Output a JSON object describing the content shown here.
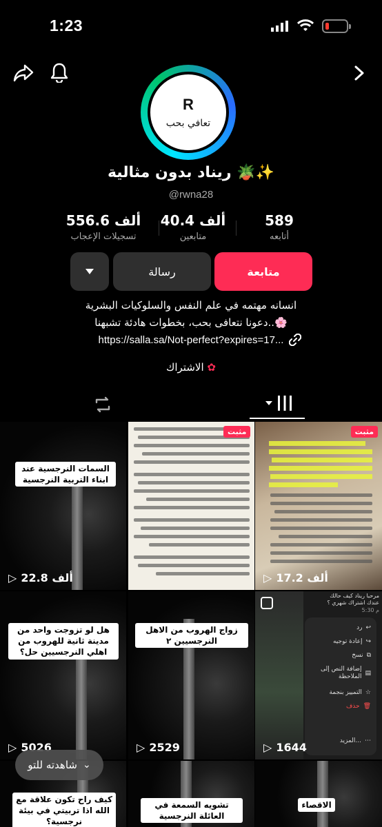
{
  "status_bar": {
    "time": "1:23"
  },
  "profile": {
    "avatar_letter": "R",
    "avatar_text": "تعافي بحب",
    "display_name": "ريناد بدون مثالية 🪴✨",
    "handle": "@rwna28"
  },
  "stats": [
    {
      "value": "589",
      "label": "أتابعه"
    },
    {
      "value": "40.4 ألف",
      "label": "متابعين"
    },
    {
      "value": "556.6 ألف",
      "label": "تسجيلات الإعجاب"
    }
  ],
  "buttons": {
    "follow": "متابعة",
    "message": "رسالة"
  },
  "bio": {
    "line1": "انسانه مهتمه في علم النفس والسلوكيات البشرية",
    "line2": "دعونا نتعافى بحب، بخطوات هادئة تشبهنا..🌸",
    "link": "https://salla.sa/Not-perfect?expires=17..."
  },
  "subscription": {
    "label": "الاشتراك"
  },
  "videos": [
    {
      "caption": "السمات النرجسية عند ابناء التربية النرجسية",
      "views": "22.8 ألف",
      "pinned": ""
    },
    {
      "caption": "",
      "views": "",
      "pinned": ""
    },
    {
      "caption": "",
      "views": "17.2 ألف",
      "pinned": "مثبت"
    },
    {
      "caption": "هل لو تزوجت واحد من مدينة ثانية للهروب من اهلي النرجسيين حل؟",
      "views": "5026",
      "pinned": ""
    },
    {
      "caption": "زواج الهروب من الاهل النرجسيين ٢",
      "views": "2529",
      "pinned": ""
    },
    {
      "caption": "",
      "views": "1644",
      "pinned": ""
    },
    {
      "caption": "كيف راح تكون علاقة مع الله اذا تربيتي في بيئة نرجسية؟",
      "views": "",
      "pinned": ""
    },
    {
      "caption": "تشويه السمعة في العائلة النرجسية",
      "views": "",
      "pinned": ""
    },
    {
      "caption": "الاقصاء",
      "views": "",
      "pinned": ""
    }
  ],
  "pinned_label_2": "مثبت",
  "chat_overlay": {
    "line1": "مرحبا ريناد كيف حالك",
    "line2": "عندك اشتراك شهري ؟",
    "time": "5:30 م",
    "menu": [
      "رد",
      "إعادة توجيه",
      "نسخ",
      "إضافة النص إلى الملاحظة",
      "التمييز بنجمة",
      "حذف",
      "المزيد..."
    ]
  },
  "floating": {
    "watch_label": "شاهدته للتو"
  }
}
